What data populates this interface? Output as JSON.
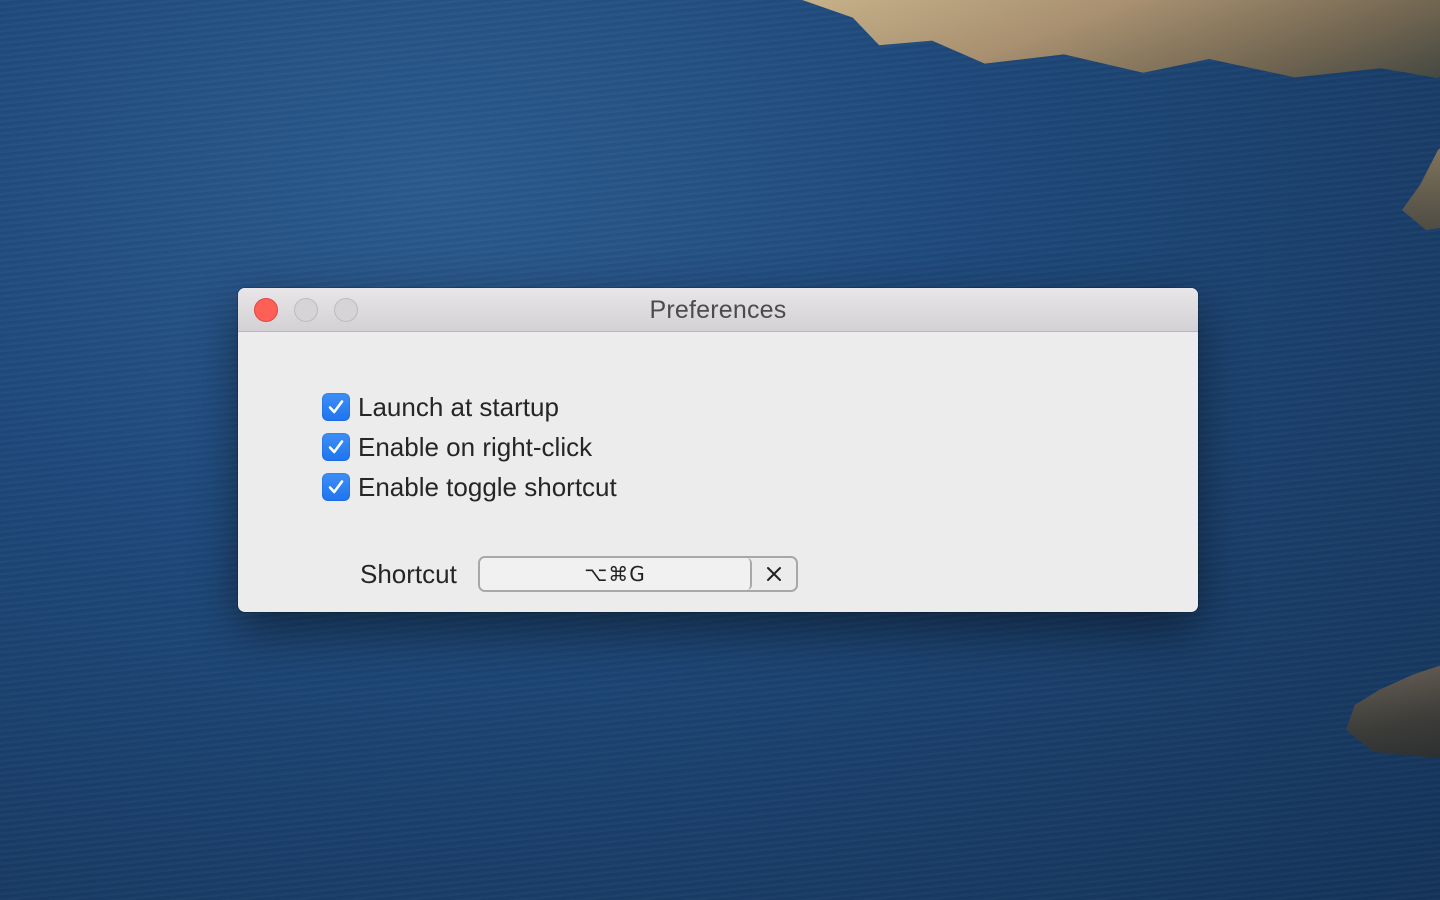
{
  "window": {
    "title": "Preferences"
  },
  "options": [
    {
      "label": "Launch at startup",
      "checked": true
    },
    {
      "label": "Enable on right-click",
      "checked": true
    },
    {
      "label": "Enable toggle shortcut",
      "checked": true
    }
  ],
  "shortcut": {
    "label": "Shortcut",
    "value": "⌥⌘G",
    "clear_icon": "close-x-icon"
  },
  "colors": {
    "accent": "#2a7ef2",
    "close_button": "#fe5f57",
    "window_background": "#ececec"
  }
}
